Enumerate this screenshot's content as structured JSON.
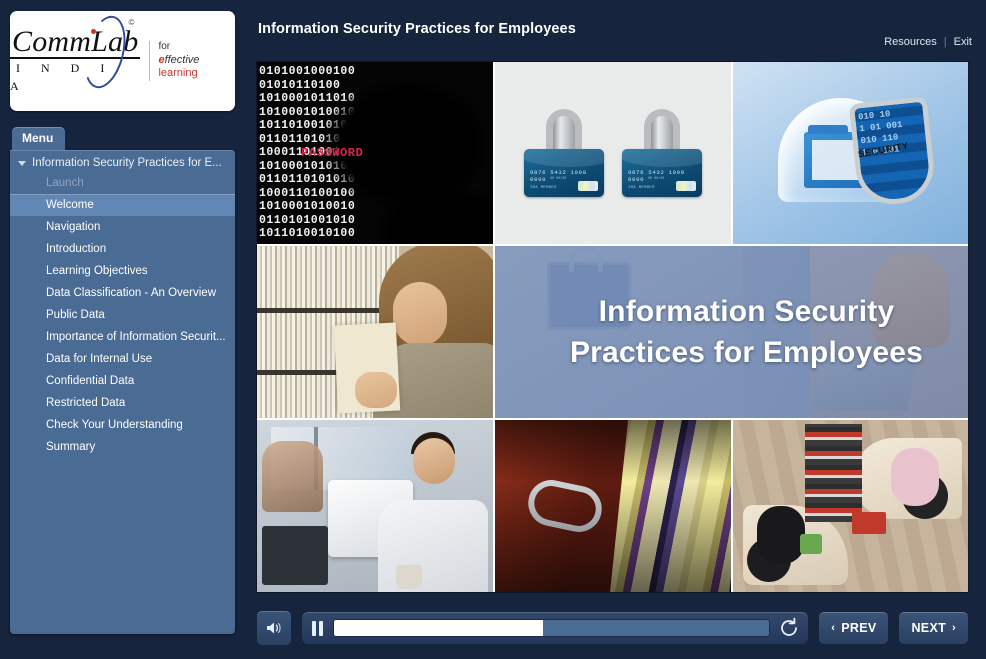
{
  "brand": {
    "name_main": "CommLab",
    "name_sub": "I N D I A",
    "reg_mark": "©",
    "tagline_line1": "for",
    "tagline_e": "e",
    "tagline_ffective": "ffective",
    "tagline_learning": " learning"
  },
  "sidebar": {
    "menu_tab_label": "Menu",
    "root_label": "Information Security Practices for E...",
    "items": [
      {
        "label": "Launch",
        "state": "visited"
      },
      {
        "label": "Welcome",
        "state": "selected"
      },
      {
        "label": "Navigation",
        "state": "normal"
      },
      {
        "label": "Introduction",
        "state": "normal"
      },
      {
        "label": "Learning Objectives",
        "state": "normal"
      },
      {
        "label": "Data Classification - An Overview",
        "state": "normal"
      },
      {
        "label": "Public Data",
        "state": "normal"
      },
      {
        "label": "Importance of Information Securit...",
        "state": "normal"
      },
      {
        "label": "Data for Internal Use",
        "state": "normal"
      },
      {
        "label": "Confidential Data",
        "state": "normal"
      },
      {
        "label": "Restricted Data",
        "state": "normal"
      },
      {
        "label": "Check Your Understanding",
        "state": "normal"
      },
      {
        "label": "Summary",
        "state": "normal"
      }
    ]
  },
  "header": {
    "course_title": "Information Security Practices for Employees",
    "resources_label": "Resources",
    "separator": "|",
    "exit_label": "Exit"
  },
  "slide": {
    "title_line1": "Information Security",
    "title_line2": "Practices for Employees",
    "tiles": {
      "binary": {
        "name": "binary-code-password-image",
        "password_text": "PASSWORD",
        "binary_rows": "0101001000100\n01010110100\n1010001011010\n1010001010010\n1011010010100\n0110110101010\n1000110100100\n1010001010100\n0110110101010\n1000110100100\n1010001010010\n0110101001010\n1011010010100"
      },
      "cards": {
        "name": "padlock-credit-cards-image",
        "card_number": "9876 5432 1000 0000",
        "card_expiry": "00 00/00",
        "card_name": "IMA MEMBER"
      },
      "dome": {
        "name": "security-folder-dome-image",
        "security_label": "SECURITY",
        "visor_binary": "010 10\n1 01 001\n010 110\n1 0 101"
      },
      "files": {
        "name": "woman-retrieving-files-image"
      },
      "office": {
        "name": "office-workers-image"
      },
      "cabinet": {
        "name": "file-cabinet-folders-image"
      },
      "aerial": {
        "name": "aerial-office-desks-image"
      }
    }
  },
  "controls": {
    "volume_label": "Volume",
    "pause_label": "Pause",
    "replay_label": "Replay",
    "progress_percent": 48,
    "prev_label": "PREV",
    "next_label": "NEXT",
    "prev_chevron": "‹",
    "next_chevron": "›"
  },
  "colors": {
    "frame_dark": "#16243e",
    "panel_blue": "#4a6b93",
    "selected_blue": "#6287b5",
    "accent_red": "#c0392b",
    "text_white": "#ffffff"
  }
}
